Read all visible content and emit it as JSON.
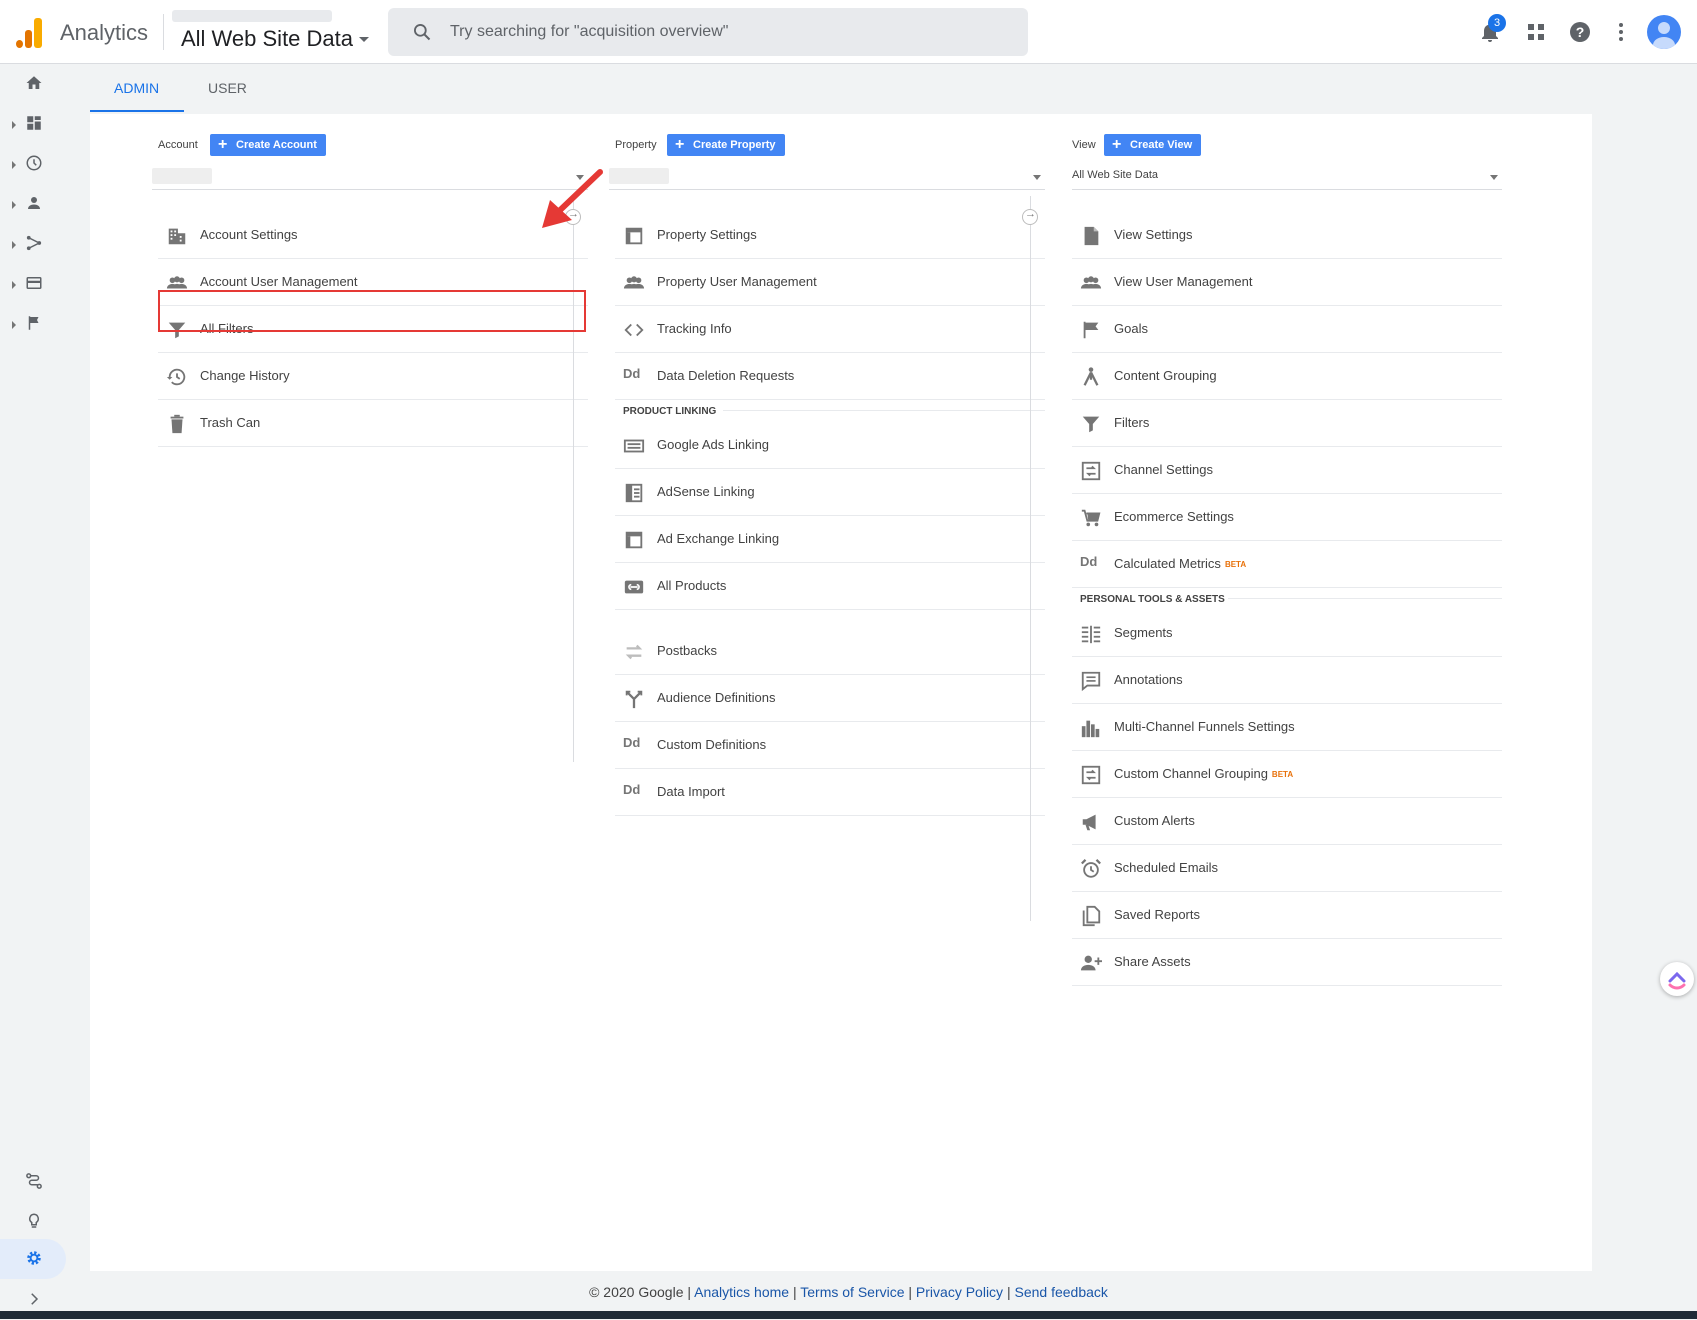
{
  "header": {
    "app_title": "Analytics",
    "view_name": "All Web Site Data",
    "search_placeholder": "Try searching for \"acquisition overview\"",
    "notification_count": "3"
  },
  "tabs": [
    {
      "label": "ADMIN",
      "active": true
    },
    {
      "label": "USER",
      "active": false
    }
  ],
  "account": {
    "label": "Account",
    "create_label": "Create Account",
    "items": [
      {
        "label": "Account Settings",
        "icon": "building-icon"
      },
      {
        "label": "Account User Management",
        "icon": "people-icon"
      },
      {
        "label": "All Filters",
        "icon": "filter-icon"
      },
      {
        "label": "Change History",
        "icon": "history-icon"
      },
      {
        "label": "Trash Can",
        "icon": "trash-icon"
      }
    ]
  },
  "property": {
    "label": "Property",
    "create_label": "Create Property",
    "items": [
      {
        "label": "Property Settings",
        "icon": "layout-icon"
      },
      {
        "label": "Property User Management",
        "icon": "people-icon"
      },
      {
        "label": "Tracking Info",
        "icon": "code-icon"
      },
      {
        "label": "Data Deletion Requests",
        "icon": "dd-icon"
      }
    ],
    "section_label": "PRODUCT LINKING",
    "linking_items": [
      {
        "label": "Google Ads Linking",
        "icon": "ads-icon"
      },
      {
        "label": "AdSense Linking",
        "icon": "adsense-icon"
      },
      {
        "label": "Ad Exchange Linking",
        "icon": "layout-icon"
      },
      {
        "label": "All Products",
        "icon": "link-icon"
      }
    ],
    "more_items": [
      {
        "label": "Postbacks",
        "icon": "postbacks-icon"
      },
      {
        "label": "Audience Definitions",
        "icon": "fork-icon"
      },
      {
        "label": "Custom Definitions",
        "icon": "dd-icon"
      },
      {
        "label": "Data Import",
        "icon": "dd-icon"
      }
    ]
  },
  "view": {
    "label": "View",
    "create_label": "Create View",
    "selected": "All Web Site Data",
    "items": [
      {
        "label": "View Settings",
        "icon": "document-icon"
      },
      {
        "label": "View User Management",
        "icon": "people-icon"
      },
      {
        "label": "Goals",
        "icon": "flag-icon"
      },
      {
        "label": "Content Grouping",
        "icon": "grouping-icon"
      },
      {
        "label": "Filters",
        "icon": "filter-icon"
      },
      {
        "label": "Channel Settings",
        "icon": "channel-icon"
      },
      {
        "label": "Ecommerce Settings",
        "icon": "cart-icon"
      },
      {
        "label": "Calculated Metrics",
        "icon": "dd-icon",
        "beta": "BETA"
      }
    ],
    "section_label": "PERSONAL TOOLS & ASSETS",
    "tools_items": [
      {
        "label": "Segments",
        "icon": "segments-icon"
      },
      {
        "label": "Annotations",
        "icon": "comment-icon"
      },
      {
        "label": "Multi-Channel Funnels Settings",
        "icon": "bars-icon"
      },
      {
        "label": "Custom Channel Grouping",
        "icon": "channel-icon",
        "beta": "BETA"
      },
      {
        "label": "Custom Alerts",
        "icon": "megaphone-icon"
      },
      {
        "label": "Scheduled Emails",
        "icon": "alarm-icon"
      },
      {
        "label": "Saved Reports",
        "icon": "copy-icon"
      },
      {
        "label": "Share Assets",
        "icon": "person-add-icon"
      }
    ]
  },
  "footer": {
    "copyright": "© 2020 Google",
    "links": [
      "Analytics home",
      "Terms of Service",
      "Privacy Policy",
      "Send feedback"
    ]
  },
  "colors": {
    "accent": "#1a73e8",
    "button": "#4285f4",
    "highlight": "#e53935",
    "beta": "#e8710a"
  }
}
